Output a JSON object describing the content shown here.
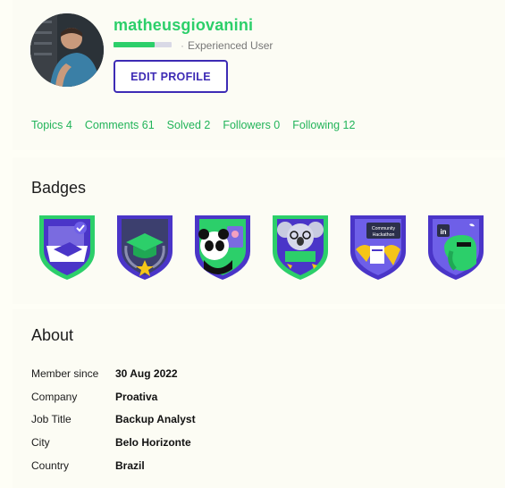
{
  "profile": {
    "username": "matheusgiovanini",
    "rank_label": "Experienced User",
    "rank_progress": 0.7,
    "edit_button": "EDIT PROFILE"
  },
  "stats": [
    {
      "label": "Topics 4"
    },
    {
      "label": "Comments 61"
    },
    {
      "label": "Solved 2"
    },
    {
      "label": "Followers 0"
    },
    {
      "label": "Following 12"
    }
  ],
  "badges": {
    "title": "Badges",
    "items": [
      {
        "icon": "graduation-laptop-badge-icon"
      },
      {
        "icon": "graduation-cap-laurel-badge-icon"
      },
      {
        "icon": "panda-badge-icon"
      },
      {
        "icon": "koala-badge-icon"
      },
      {
        "icon": "community-hackathon-badge-icon",
        "text": "Community Hackathon"
      },
      {
        "icon": "elephant-social-badge-icon",
        "text": "in"
      }
    ]
  },
  "about": {
    "title": "About",
    "rows": [
      {
        "key": "Member since",
        "value": "30 Aug 2022"
      },
      {
        "key": "Company",
        "value": "Proativa"
      },
      {
        "key": "Job Title",
        "value": "Backup Analyst"
      },
      {
        "key": "City",
        "value": "Belo Horizonte"
      },
      {
        "key": "Country",
        "value": "Brazil"
      }
    ]
  },
  "colors": {
    "accent_green": "#2ccf6a",
    "accent_purple": "#3d2bb5",
    "badge_purple": "#4a35c8"
  }
}
